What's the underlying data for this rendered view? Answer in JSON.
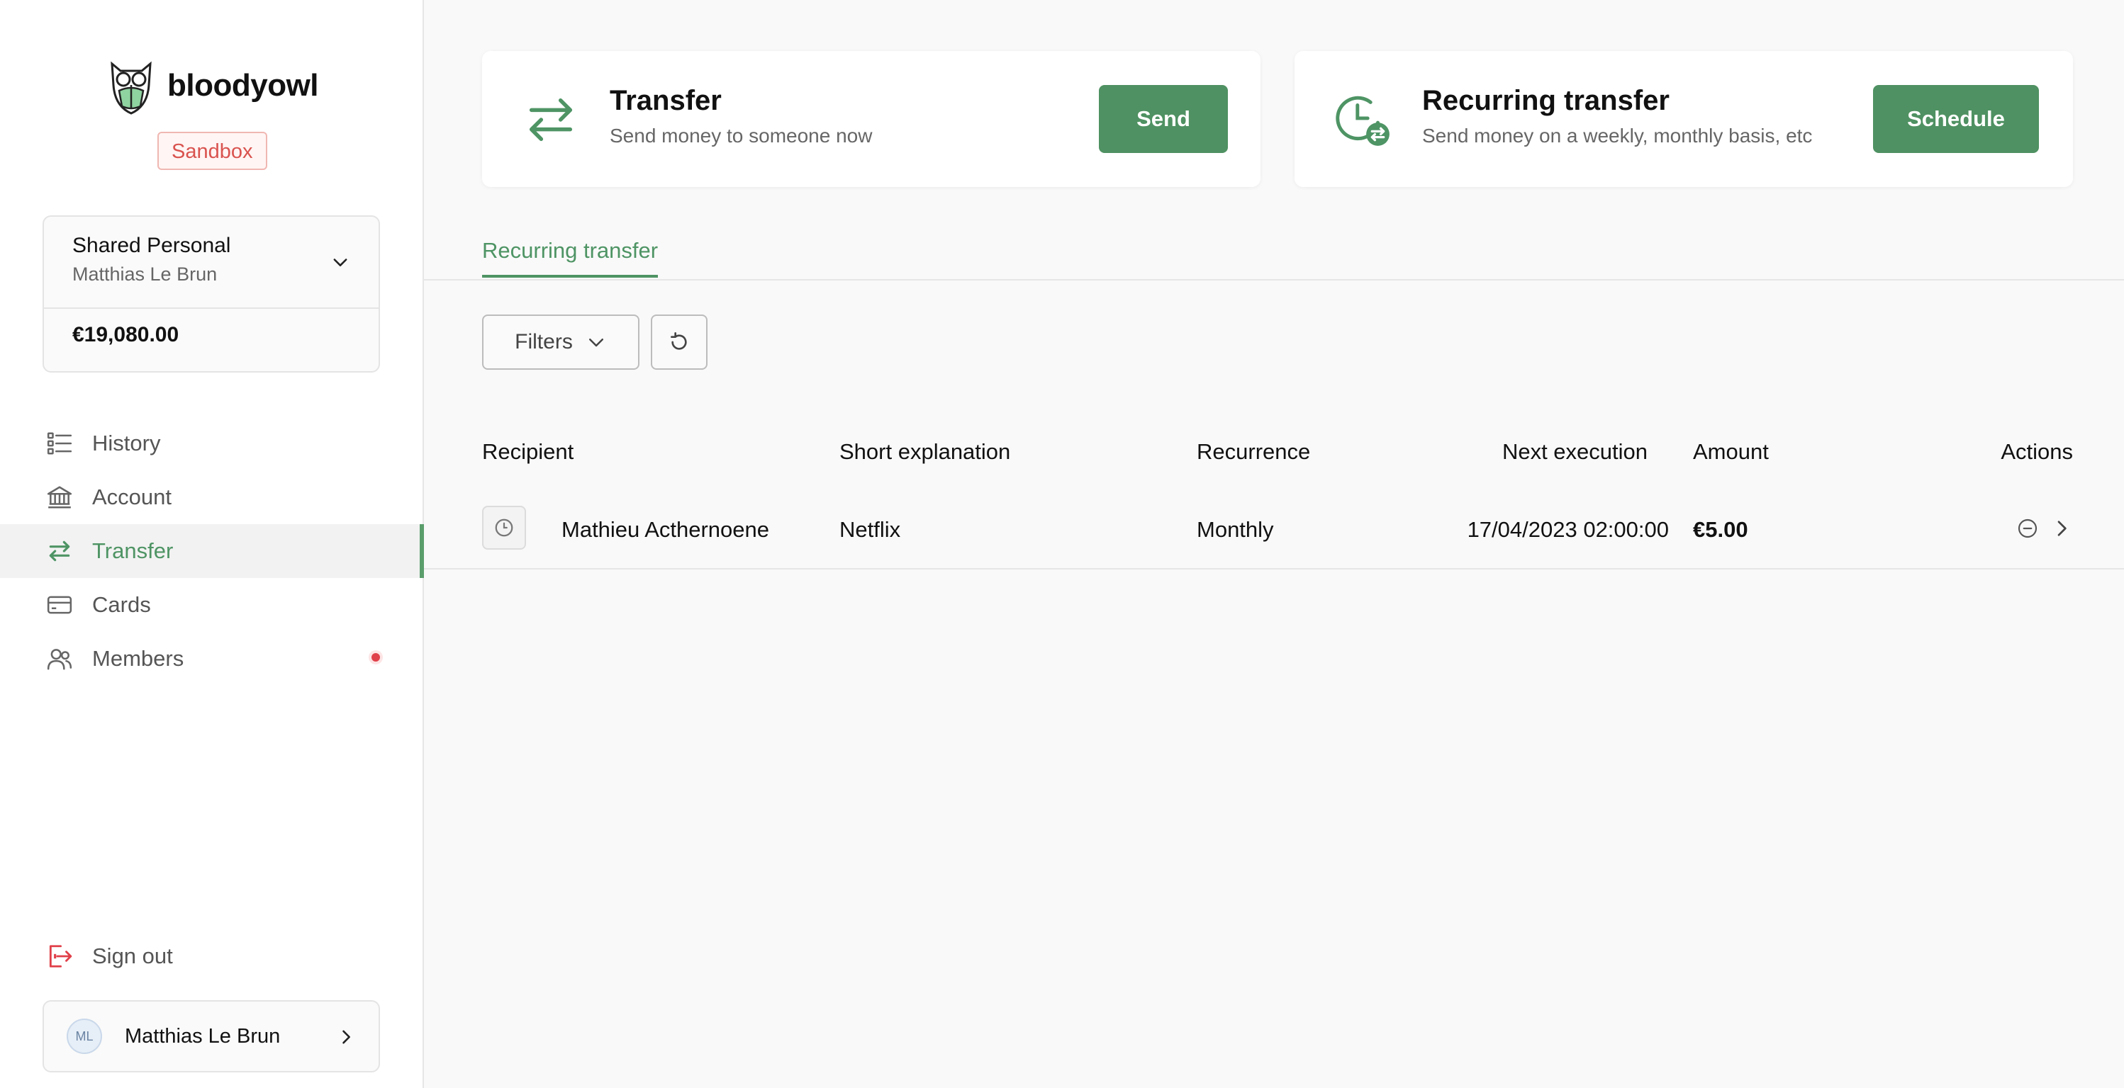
{
  "brand": {
    "name": "bloodyowl",
    "env_badge": "Sandbox"
  },
  "account": {
    "name": "Shared Personal",
    "owner": "Matthias Le Brun",
    "balance": "€19,080.00"
  },
  "nav": {
    "items": [
      {
        "label": "History",
        "icon": "list-icon"
      },
      {
        "label": "Account",
        "icon": "bank-icon"
      },
      {
        "label": "Transfer",
        "icon": "transfer-arrows-icon",
        "active": true
      },
      {
        "label": "Cards",
        "icon": "card-icon"
      },
      {
        "label": "Members",
        "icon": "members-icon",
        "notification": true
      }
    ],
    "signout": "Sign out"
  },
  "user": {
    "initials": "ML",
    "name": "Matthias Le Brun"
  },
  "actions": {
    "transfer": {
      "title": "Transfer",
      "subtitle": "Send money to someone now",
      "button": "Send"
    },
    "recurring": {
      "title": "Recurring transfer",
      "subtitle": "Send money on a weekly, monthly basis, etc",
      "button": "Schedule"
    }
  },
  "tabs": {
    "active": "Recurring transfer"
  },
  "toolbar": {
    "filters": "Filters"
  },
  "table": {
    "headers": {
      "recipient": "Recipient",
      "explanation": "Short explanation",
      "recurrence": "Recurrence",
      "next": "Next execution",
      "amount": "Amount",
      "actions": "Actions"
    },
    "rows": [
      {
        "recipient": "Mathieu Acthernoene",
        "explanation": "Netflix",
        "recurrence": "Monthly",
        "next": "17/04/2023 02:00:00",
        "amount": "€5.00"
      }
    ]
  },
  "colors": {
    "accent": "#4f9162",
    "badge": "#d9534f",
    "notification": "#e0404a"
  }
}
